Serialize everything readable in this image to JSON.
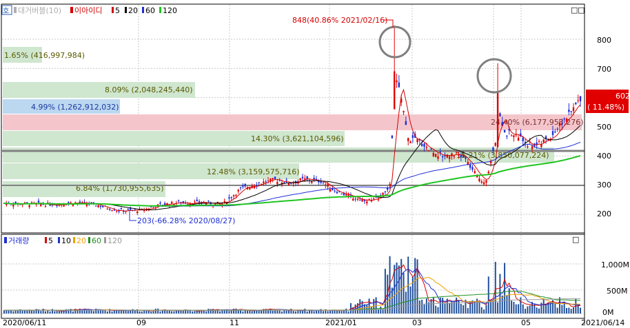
{
  "price_panel": {
    "corner_badge": "호",
    "legend": {
      "title": "대거버블(10)",
      "indicator_name": "이아이디",
      "ma_items": [
        {
          "label": "5",
          "color": "#d40000"
        },
        {
          "label": "20",
          "color": "#000000"
        },
        {
          "label": "60",
          "color": "#1f2fd6"
        },
        {
          "label": "120",
          "color": "#1fc41f"
        }
      ]
    },
    "y_axis_labels": [
      "800",
      "700",
      "600",
      "500",
      "400",
      "300",
      "200"
    ],
    "price_badge": {
      "price": "602",
      "change": "( 11.48%)"
    },
    "annotations": {
      "peak": "848(40.86% 2021/02/16)",
      "low": "203(-66.28% 2020/08/27)"
    },
    "volume_bubbles": [
      {
        "text": "1.65% (416,997,984)",
        "color": "#cfe6cf"
      },
      {
        "text": "8.09% (2,048,245,440)",
        "color": "#cfe6cf"
      },
      {
        "text": "4.99% (1,262,912,032)",
        "color": "#bcd7f0"
      },
      {
        "text": "24.40% (6,177,953,276)",
        "color": "#f4c6cc"
      },
      {
        "text": "14.30% (3,621,104,596)",
        "color": "#cfe6cf"
      },
      {
        "text": "15.21% (3,850,077,224)",
        "color": "#cfe6cf"
      },
      {
        "text": "12.48% (3,159,575,716)",
        "color": "#cfe6cf"
      },
      {
        "text": "6.84% (1,730,955,635)",
        "color": "#cfe6cf"
      }
    ]
  },
  "volume_panel": {
    "legend": {
      "title": "거래량",
      "items": [
        {
          "label": "5",
          "color": "#d40000"
        },
        {
          "label": "10",
          "color": "#1f2fd6"
        },
        {
          "label": "20",
          "color": "#f0a000"
        },
        {
          "label": "60",
          "color": "#1f8f1f"
        },
        {
          "label": "120",
          "color": "#999999"
        }
      ]
    },
    "y_axis_labels": [
      "1,000M",
      "500M",
      "0M"
    ]
  },
  "x_axis_labels": [
    "2020/06/11",
    "09",
    "11",
    "2021/01",
    "03",
    "05",
    "2021/06/14"
  ],
  "window_buttons": [
    "□",
    "□",
    "□"
  ],
  "chart_data": {
    "type": "candlestick",
    "title": "",
    "ylim": [
      150,
      860
    ],
    "volume_ylim": [
      0,
      1400
    ],
    "x_start": "2020/06/11",
    "x_end": "2021/06/14",
    "price_levels": [
      420,
      296
    ],
    "moving_averages": [
      "5",
      "20",
      "60",
      "120"
    ],
    "key_points": [
      {
        "date": "2021/02/16",
        "price": 848,
        "change_pct": 40.86
      },
      {
        "date": "2020/08/27",
        "price": 203,
        "change_pct": -66.28
      },
      {
        "date": "2021/06/14",
        "price": 602,
        "change_pct": 11.48
      }
    ]
  }
}
